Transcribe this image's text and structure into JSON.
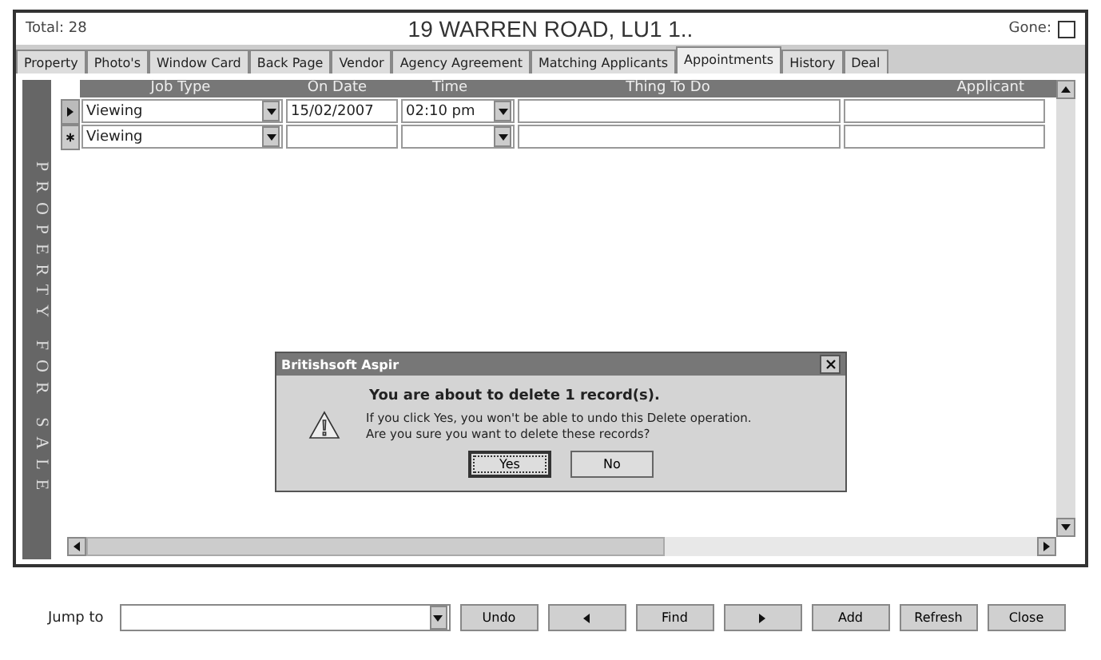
{
  "header": {
    "total": "Total: 28",
    "title": "19 WARREN ROAD,  LU1 1..",
    "gone_label": "Gone:",
    "gone_checked": false
  },
  "tabs": [
    {
      "label": "Property",
      "selected": false
    },
    {
      "label": "Photo's",
      "selected": false
    },
    {
      "label": "Window Card",
      "selected": false
    },
    {
      "label": "Back Page",
      "selected": false
    },
    {
      "label": "Vendor",
      "selected": false
    },
    {
      "label": "Agency Agreement",
      "selected": false
    },
    {
      "label": "Matching Applicants",
      "selected": false
    },
    {
      "label": "Appointments",
      "selected": true
    },
    {
      "label": "History",
      "selected": false
    },
    {
      "label": "Deal",
      "selected": false
    }
  ],
  "side_label": "PROPERTY FOR SALE",
  "table": {
    "columns": [
      "Job Type",
      "On Date",
      "Time",
      "Thing To Do",
      "Applicant"
    ],
    "rows": [
      {
        "kind": "current",
        "selected": true,
        "job_type": "Viewing",
        "on_date": "15/02/2007",
        "time": "02:10 pm",
        "thing_to_do": "",
        "applicant": ""
      },
      {
        "kind": "new",
        "selected": false,
        "job_type": "Viewing",
        "on_date": "",
        "time": "",
        "thing_to_do": "",
        "applicant": ""
      }
    ]
  },
  "dialog": {
    "title": "Britishsoft Aspir",
    "message": "You are about to delete 1 record(s).",
    "detail": [
      "If you click Yes, you won't be able to undo this Delete operation.",
      "Are you sure you want to delete these records?"
    ],
    "buttons": [
      {
        "label": "Yes",
        "selected": true
      },
      {
        "label": "No",
        "selected": false
      }
    ]
  },
  "footer": {
    "jump_label": "Jump to",
    "buttons": [
      {
        "kind": "text",
        "label": "Undo"
      },
      {
        "kind": "prev"
      },
      {
        "kind": "text",
        "label": "Find"
      },
      {
        "kind": "next"
      },
      {
        "kind": "text",
        "label": "Add"
      },
      {
        "kind": "text",
        "label": "Refresh"
      },
      {
        "kind": "text",
        "label": "Close"
      }
    ]
  }
}
